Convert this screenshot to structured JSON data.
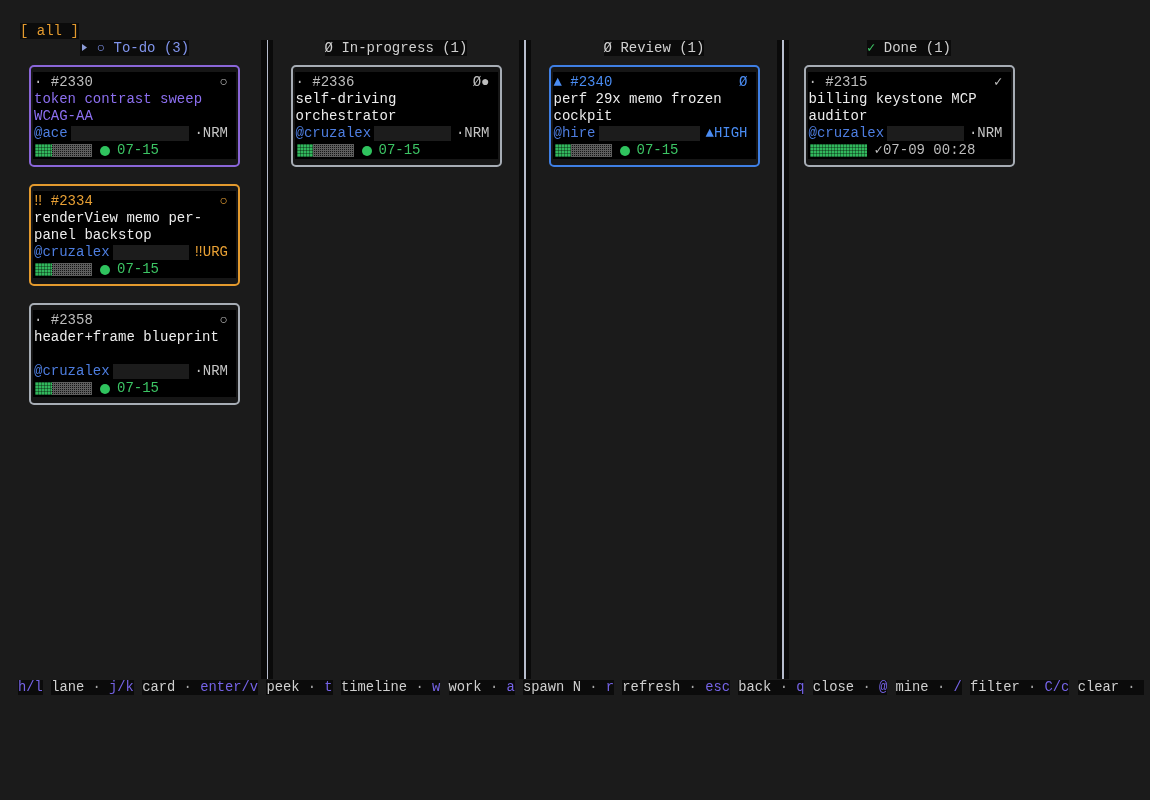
{
  "filter": "[ all ]",
  "lanes": [
    {
      "kind": "todo",
      "focused": true,
      "glyph": "○",
      "title": "To-do (3)",
      "cards": [
        {
          "selected": true,
          "kind": "normal",
          "priority_glyph": "·",
          "id": "#2330",
          "status": "○",
          "title": "token contrast sweep WCAG-AA",
          "assignee": "@ace",
          "priority_label": "·NRM",
          "level": 0.29,
          "date": {
            "kind": "due",
            "text": "07-15"
          }
        },
        {
          "selected": false,
          "kind": "urgent",
          "priority_glyph": "‼",
          "id": "#2334",
          "status": "○",
          "title": "renderView memo per-panel backstop",
          "assignee": "@cruzalex",
          "priority_label": "‼URG",
          "level": 0.29,
          "date": {
            "kind": "due",
            "text": "07-15"
          }
        },
        {
          "selected": false,
          "kind": "normal",
          "priority_glyph": "·",
          "id": "#2358",
          "status": "○",
          "title": "header+frame blueprint",
          "assignee": "@cruzalex",
          "priority_label": "·NRM",
          "level": 0.29,
          "date": {
            "kind": "due",
            "text": "07-15"
          }
        }
      ]
    },
    {
      "kind": "in_progress",
      "focused": false,
      "glyph": "Ø",
      "title": "In-progress (1)",
      "cards": [
        {
          "selected": false,
          "kind": "normal",
          "priority_glyph": "·",
          "id": "#2336",
          "status": "Ø●",
          "title": "self-driving orchestrator",
          "assignee": "@cruzalex",
          "priority_label": "·NRM",
          "level": 0.29,
          "date": {
            "kind": "due",
            "text": "07-15"
          }
        }
      ]
    },
    {
      "kind": "review",
      "focused": false,
      "glyph": "Ø",
      "title": "Review (1)",
      "cards": [
        {
          "selected": false,
          "kind": "high",
          "priority_glyph": "▲",
          "id": "#2340",
          "status": "Ø",
          "title": "perf 29x memo frozen cockpit",
          "assignee": "@hire",
          "priority_label": "▲HIGH",
          "level": 0.29,
          "date": {
            "kind": "due",
            "text": "07-15"
          }
        }
      ]
    },
    {
      "kind": "done",
      "focused": false,
      "glyph": "✓",
      "title": "Done (1)",
      "cards": [
        {
          "selected": false,
          "kind": "normal",
          "priority_glyph": "·",
          "id": "#2315",
          "status": "✓",
          "title": "billing keystone MCP auditor",
          "assignee": "@cruzalex",
          "priority_label": "·NRM",
          "level": 1,
          "date": {
            "kind": "completed",
            "text": "✓07-09 00:28"
          }
        }
      ]
    }
  ],
  "footer": {
    "hints": [
      {
        "key": "h/l",
        "label": "lane",
        "separator": "·"
      },
      {
        "key": "j/k",
        "label": "card",
        "separator": "·"
      },
      {
        "key": "enter/v",
        "label": "peek",
        "separator": "·"
      },
      {
        "key": "t",
        "label": "timeline",
        "separator": "·"
      },
      {
        "key": "w",
        "label": "work",
        "separator": "·"
      },
      {
        "key": "a",
        "label": "spawn N",
        "separator": "·"
      },
      {
        "key": "r",
        "label": "refresh",
        "separator": "·"
      },
      {
        "key": "esc",
        "label": "back",
        "separator": "·"
      },
      {
        "key": "q",
        "label": "close",
        "separator": "·"
      },
      {
        "key": "@",
        "label": "mine",
        "separator": "·"
      },
      {
        "key": "/",
        "label": "filter",
        "separator": "·"
      },
      {
        "key": "C/c",
        "label": "clear",
        "separator": "·"
      }
    ]
  }
}
